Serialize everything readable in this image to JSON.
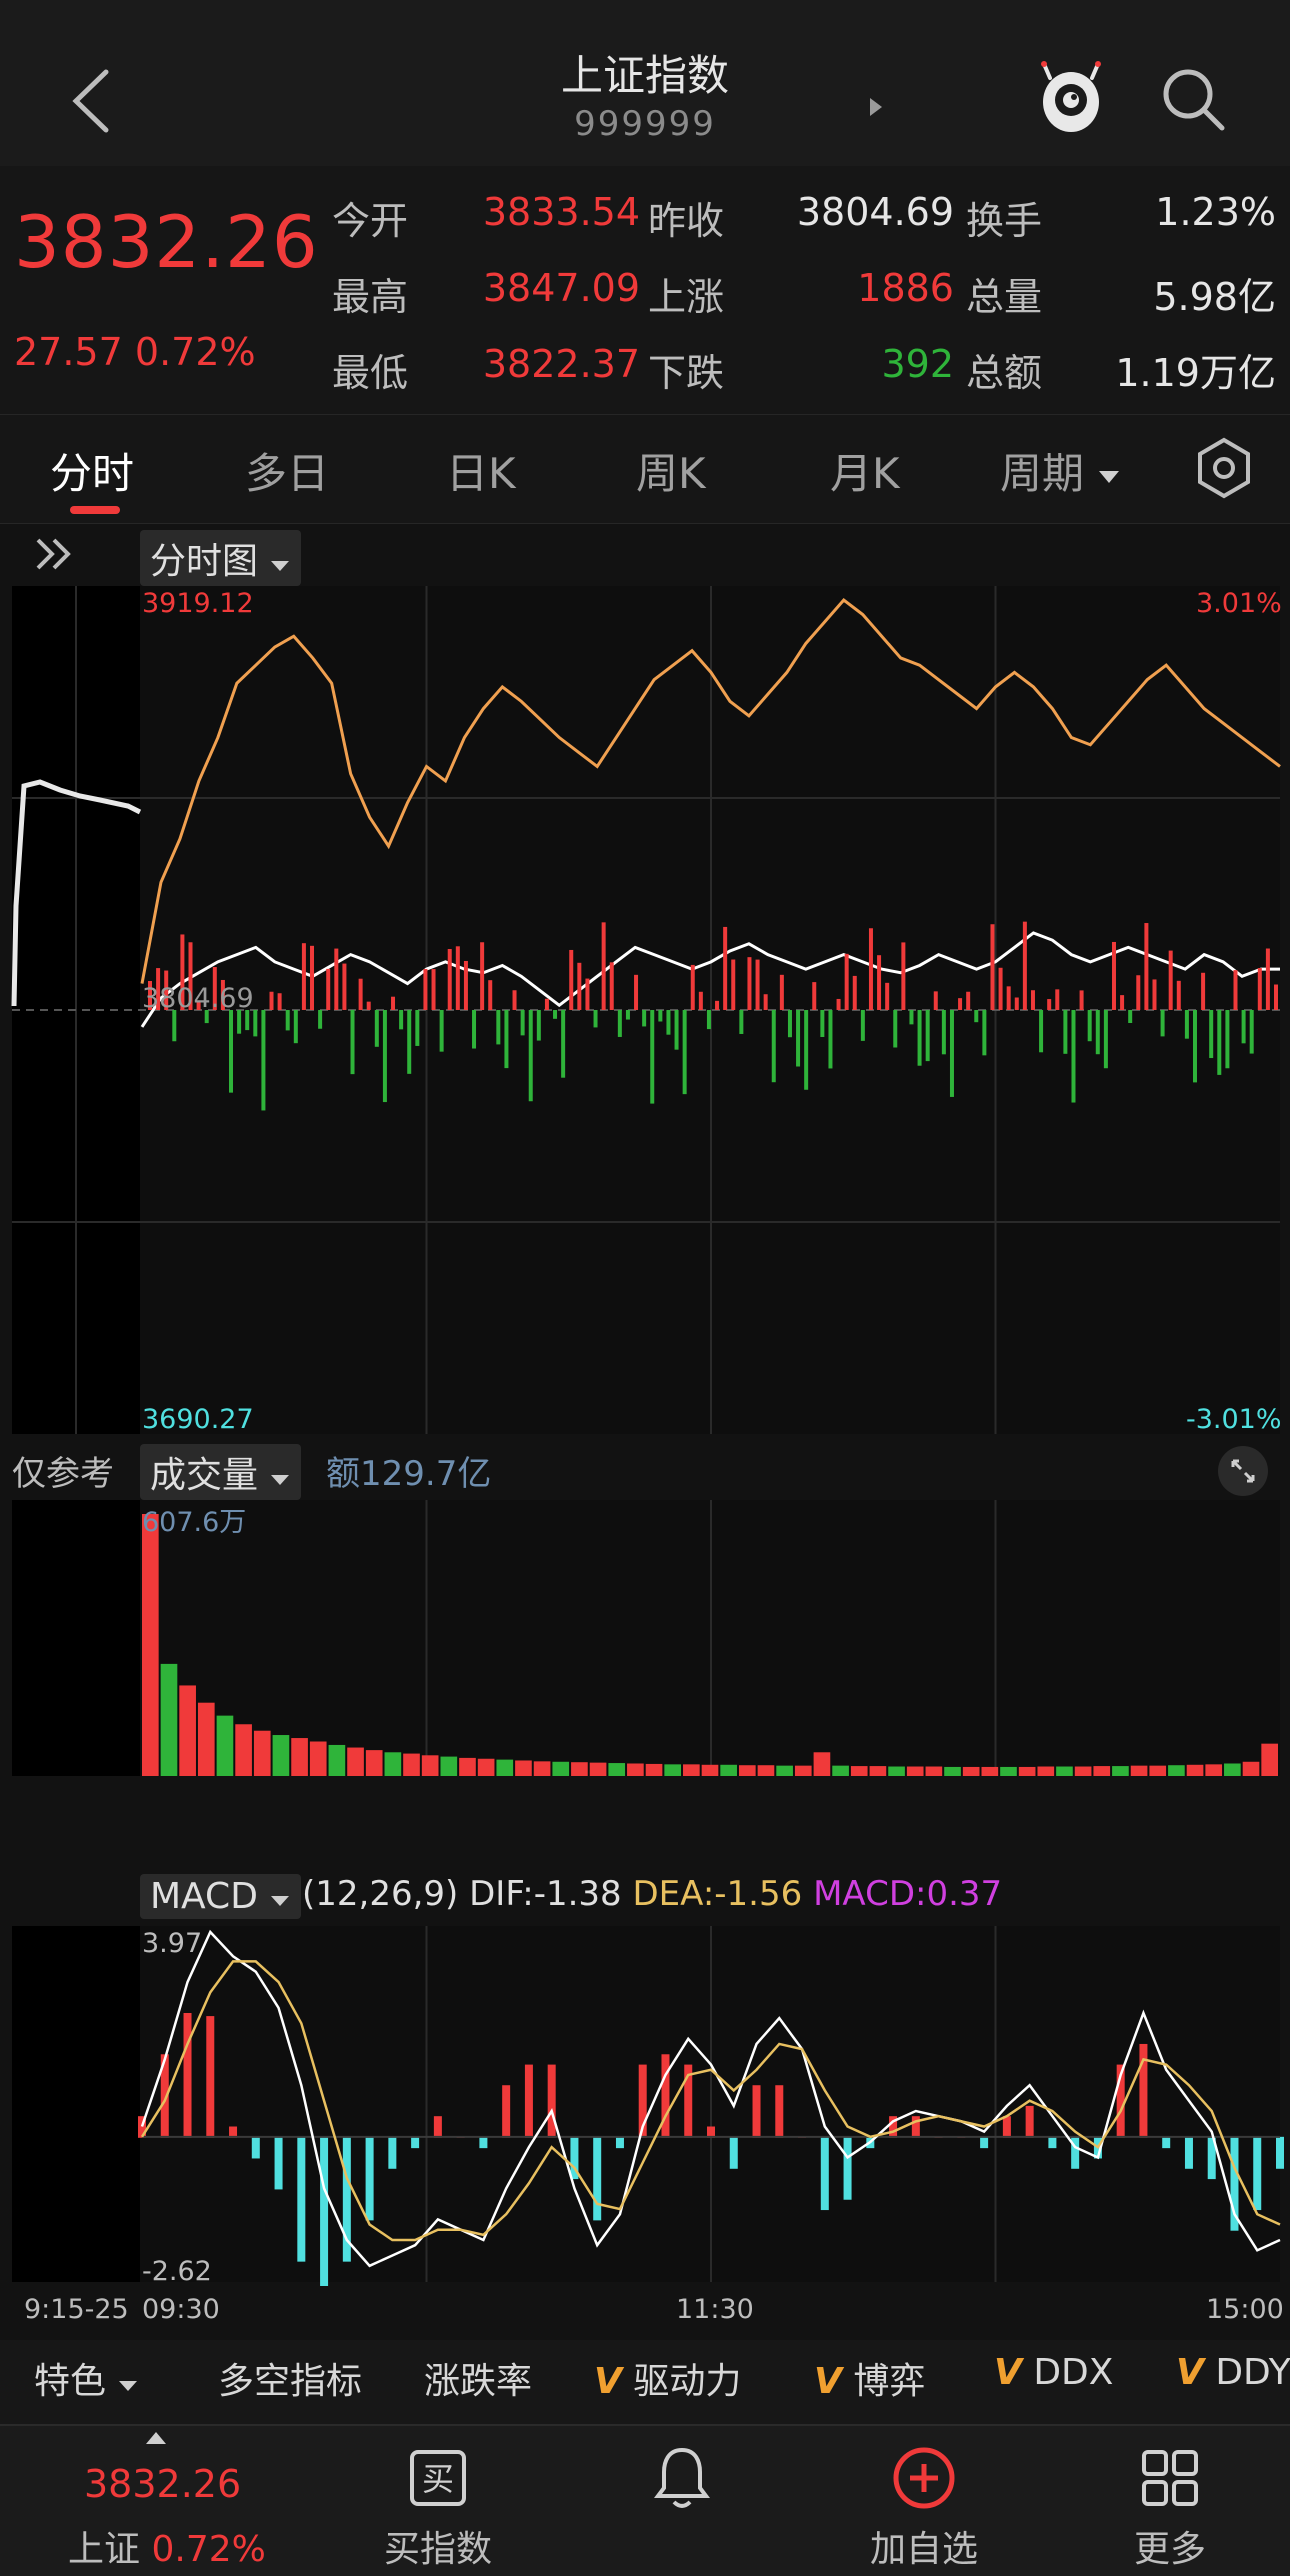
{
  "header": {
    "title": "上证指数",
    "code": "999999"
  },
  "quote": {
    "price": "3832.26",
    "change": "27.57",
    "change_pct": "0.72%",
    "rows": [
      {
        "l1": "今开",
        "v1": "3833.54",
        "c1": "red",
        "l2": "昨收",
        "v2": "3804.69",
        "c2": "white",
        "l3": "换手",
        "v3": "1.23%",
        "c3": "white"
      },
      {
        "l1": "最高",
        "v1": "3847.09",
        "c1": "red",
        "l2": "上涨",
        "v2": "1886",
        "c2": "red",
        "l3": "总量",
        "v3": "5.98亿",
        "c3": "white"
      },
      {
        "l1": "最低",
        "v1": "3822.37",
        "c1": "red",
        "l2": "下跌",
        "v2": "392",
        "c2": "green",
        "l3": "总额",
        "v3": "1.19万亿",
        "c3": "white"
      }
    ]
  },
  "tabs": [
    "分时",
    "多日",
    "日K",
    "周K",
    "月K",
    "周期"
  ],
  "main_chart": {
    "selector": "分时图",
    "high": "3919.12",
    "low": "3690.27",
    "prev_close": "3804.69",
    "pct_high": "3.01%",
    "pct_low": "-3.01%"
  },
  "volume_chart": {
    "ref_label": "仅参考",
    "selector": "成交量",
    "amount": "额129.7亿",
    "max_label": "607.6万"
  },
  "macd_chart": {
    "selector": "MACD",
    "params": "(12,26,9)",
    "dif": "DIF:-1.38",
    "dea": "DEA:-1.56",
    "macd": "MACD:0.37",
    "max": "3.97",
    "min": "-2.62"
  },
  "time_axis": [
    "9:15-25",
    "09:30",
    "11:30",
    "15:00"
  ],
  "indicator_tabs": [
    "特色",
    "多空指标",
    "涨跌率",
    "驱动力",
    "博弈",
    "DDX",
    "DDY"
  ],
  "indicator_v_mark": "V",
  "nav": {
    "price": "3832.26",
    "name": "上证",
    "pct": "0.72%",
    "items": [
      "买指数",
      "加自选",
      "更多"
    ],
    "buy_glyph": "买"
  },
  "colors": {
    "up": "#f03a3a",
    "down": "#2fb43a",
    "price_line": "#f0a050",
    "avg_line": "#ffffff",
    "dea": "#e8c060",
    "macd_text": "#d040e0",
    "cyan": "#50e0e0"
  },
  "chart_data": [
    {
      "type": "line",
      "title": "",
      "ylim": [
        3690.27,
        3919.12
      ],
      "series": [
        {
          "values": [
            3812,
            3840,
            3852,
            3868,
            3880,
            3895,
            3900,
            3905,
            3908,
            3902,
            3895,
            3870,
            3858,
            3850,
            3862,
            3872,
            3868,
            3880,
            3888,
            3894,
            3890,
            3885,
            3880,
            3876,
            3872,
            3880,
            3888,
            3896,
            3900,
            3904,
            3898,
            3890,
            3886,
            3892,
            3898,
            3906,
            3912,
            3918,
            3914,
            3908,
            3902,
            3900,
            3896,
            3892,
            3888,
            3894,
            3898,
            3894,
            3888,
            3880,
            3878,
            3884,
            3890,
            3896,
            3900,
            3894,
            3888,
            3884,
            3880,
            3876,
            3872
          ]
        },
        {
          "values": [
            3800,
            3808,
            3812,
            3815,
            3818,
            3820,
            3822,
            3818,
            3816,
            3814,
            3817,
            3820,
            3818,
            3815,
            3812,
            3816,
            3818,
            3816,
            3815,
            3817,
            3814,
            3810,
            3806,
            3810,
            3814,
            3818,
            3822,
            3820,
            3818,
            3816,
            3818,
            3821,
            3823,
            3820,
            3818,
            3816,
            3818,
            3820,
            3818,
            3816,
            3815,
            3817,
            3820,
            3818,
            3816,
            3818,
            3822,
            3826,
            3824,
            3820,
            3818,
            3820,
            3822,
            3820,
            3818,
            3816,
            3820,
            3818,
            3814,
            3816,
            3816
          ]
        }
      ]
    },
    {
      "type": "bar",
      "title": "",
      "values": [
        607.6,
        260,
        210,
        170,
        140,
        120,
        105,
        95,
        88,
        80,
        72,
        66,
        60,
        55,
        52,
        48,
        45,
        42,
        40,
        38,
        36,
        34,
        33,
        32,
        31,
        30,
        29,
        28,
        27,
        27,
        26,
        26,
        25,
        25,
        24,
        24,
        55,
        24,
        23,
        23,
        22,
        22,
        22,
        21,
        21,
        21,
        21,
        21,
        22,
        22,
        22,
        23,
        23,
        24,
        24,
        25,
        26,
        27,
        29,
        33,
        75
      ]
    },
    {
      "type": "line",
      "title": "",
      "ylim": [
        -2.62,
        3.97
      ],
      "series": [
        {
          "values": [
            0.2,
            1.5,
            3.0,
            3.97,
            3.5,
            3.2,
            2.5,
            1.0,
            -1.0,
            -2.0,
            -2.5,
            -2.3,
            -2.1,
            -1.6,
            -1.8,
            -2.0,
            -1.0,
            -0.2,
            0.5,
            -1.0,
            -2.1,
            -1.5,
            0.2,
            1.2,
            1.9,
            1.4,
            0.6,
            1.8,
            2.3,
            1.7,
            0.2,
            -0.4,
            -0.1,
            0.3,
            0.5,
            0.4,
            0.3,
            0.1,
            0.6,
            1.0,
            0.4,
            -0.2,
            -0.4,
            1.2,
            2.4,
            1.3,
            0.7,
            0.1,
            -1.5,
            -2.2,
            -2.0
          ]
        },
        {
          "values": [
            0.0,
            0.7,
            1.8,
            2.8,
            3.4,
            3.4,
            3.0,
            2.2,
            0.7,
            -0.8,
            -1.7,
            -2.0,
            -2.0,
            -1.8,
            -1.8,
            -1.9,
            -1.5,
            -0.9,
            -0.2,
            -0.6,
            -1.3,
            -1.4,
            -0.5,
            0.4,
            1.2,
            1.3,
            0.9,
            1.3,
            1.8,
            1.7,
            0.9,
            0.2,
            0.0,
            0.1,
            0.3,
            0.4,
            0.3,
            0.2,
            0.4,
            0.7,
            0.5,
            0.1,
            -0.2,
            0.5,
            1.5,
            1.4,
            1.0,
            0.5,
            -0.6,
            -1.5,
            -1.7
          ]
        }
      ]
    }
  ]
}
